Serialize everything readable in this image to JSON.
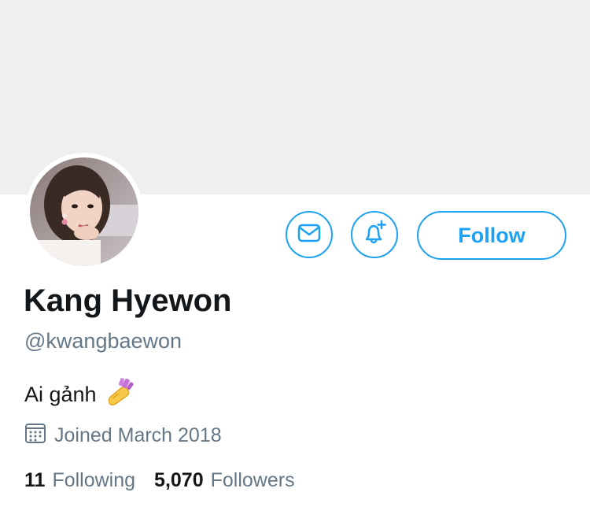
{
  "profile": {
    "display_name": "Kang Hyewon",
    "handle": "@kwangbaewon",
    "bio": "Ai gảnh",
    "bio_emoji": "nail-polish-emoji",
    "joined": "Joined March 2018"
  },
  "actions": {
    "message_icon": "envelope-icon",
    "notify_icon": "bell-plus-icon",
    "follow_label": "Follow"
  },
  "stats": {
    "following_count": "11",
    "following_label": "Following",
    "followers_count": "5,070",
    "followers_label": "Followers"
  },
  "colors": {
    "accent": "#1da1f2",
    "banner": "#efeff2",
    "text_primary": "#14171a",
    "text_secondary": "#657786"
  }
}
